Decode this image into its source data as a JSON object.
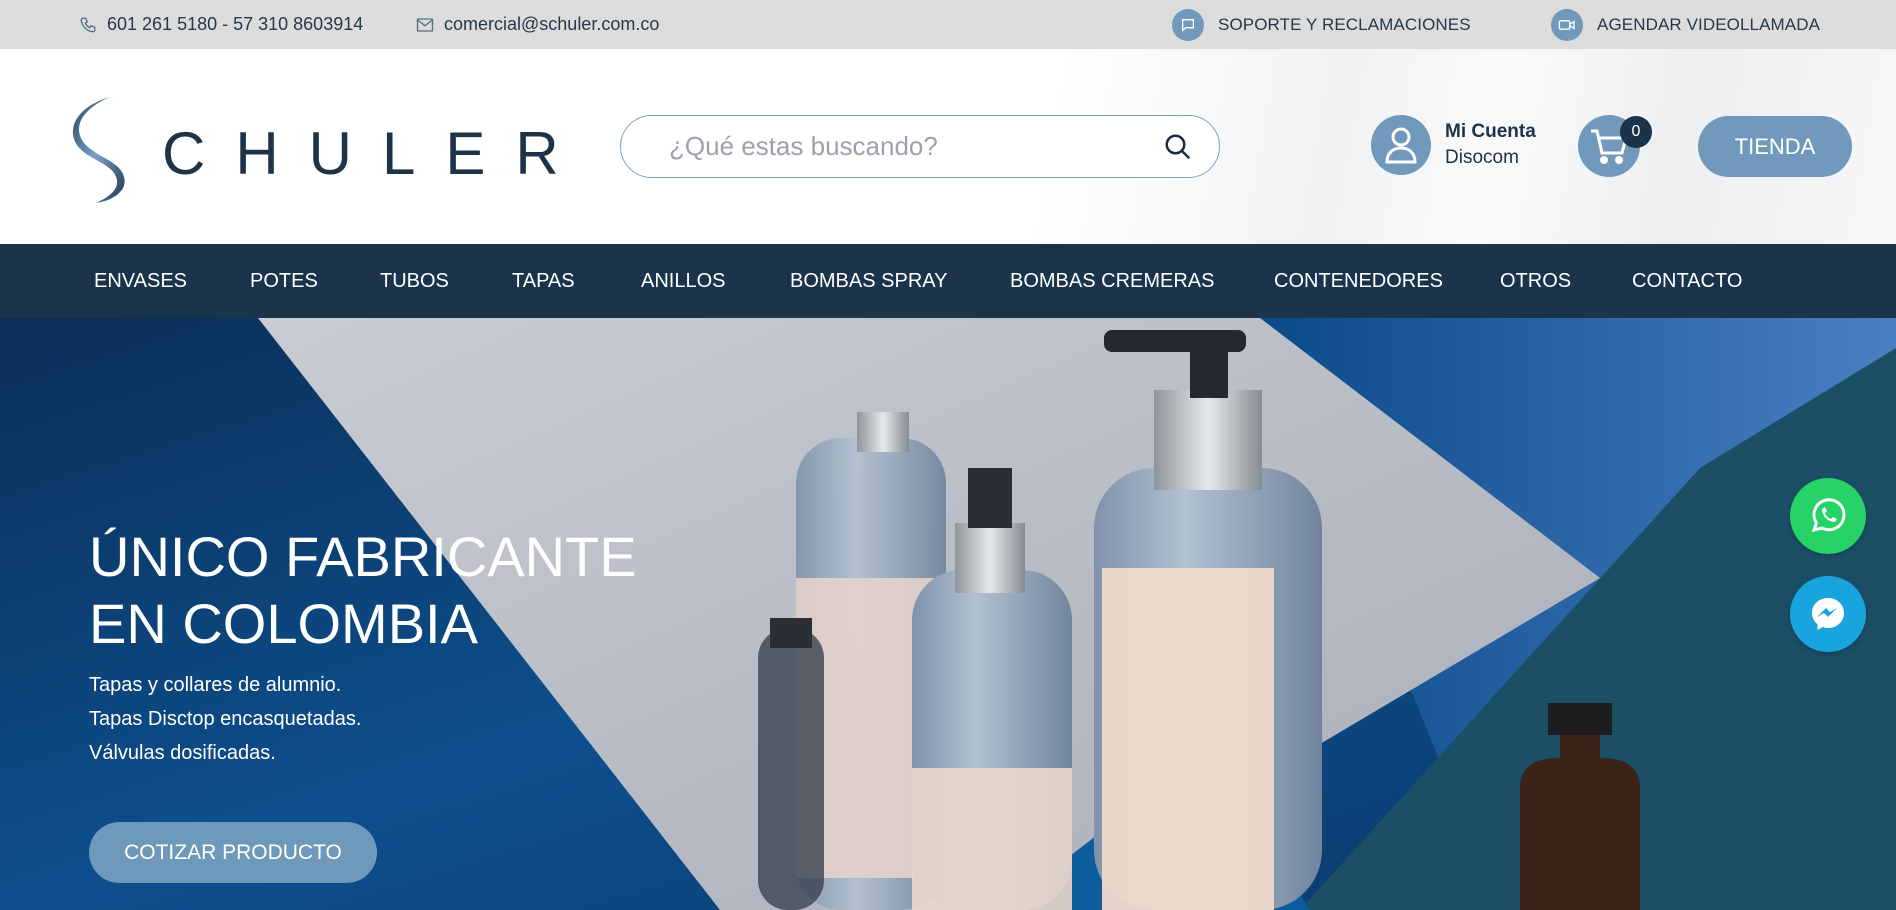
{
  "topbar": {
    "phone": "601 261 5180 - 57 310 8603914",
    "email": "comercial@schuler.com.co",
    "support": "SOPORTE Y RECLAMACIONES",
    "video_call": "AGENDAR VIDEOLLAMADA"
  },
  "header": {
    "logo_text": "CHULER",
    "search_placeholder": "¿Qué estas buscando?",
    "account_title": "Mi Cuenta",
    "account_user": "Disocom",
    "cart_count": "0",
    "shop_button": "TIENDA"
  },
  "nav": {
    "items": [
      "ENVASES",
      "POTES",
      "TUBOS",
      "TAPAS",
      "ANILLOS",
      "BOMBAS SPRAY",
      "BOMBAS CREMERAS",
      "CONTENEDORES",
      "OTROS",
      "CONTACTO"
    ]
  },
  "hero": {
    "title_line1": "ÚNICO FABRICANTE",
    "title_line2": "EN COLOMBIA",
    "lines": [
      "Tapas y collares de alumnio.",
      "Tapas Disctop encasquetadas.",
      "Válvulas dosificadas."
    ],
    "cta": "COTIZAR PRODUCTO"
  },
  "colors": {
    "accent": "#7099bb",
    "navy": "#1b334b",
    "whatsapp": "#25d366",
    "messenger": "#1aa4dd"
  },
  "icons": [
    "phone-icon",
    "mail-icon",
    "chat-icon",
    "video-icon",
    "search-icon",
    "user-icon",
    "cart-icon",
    "whatsapp-icon",
    "messenger-icon"
  ]
}
